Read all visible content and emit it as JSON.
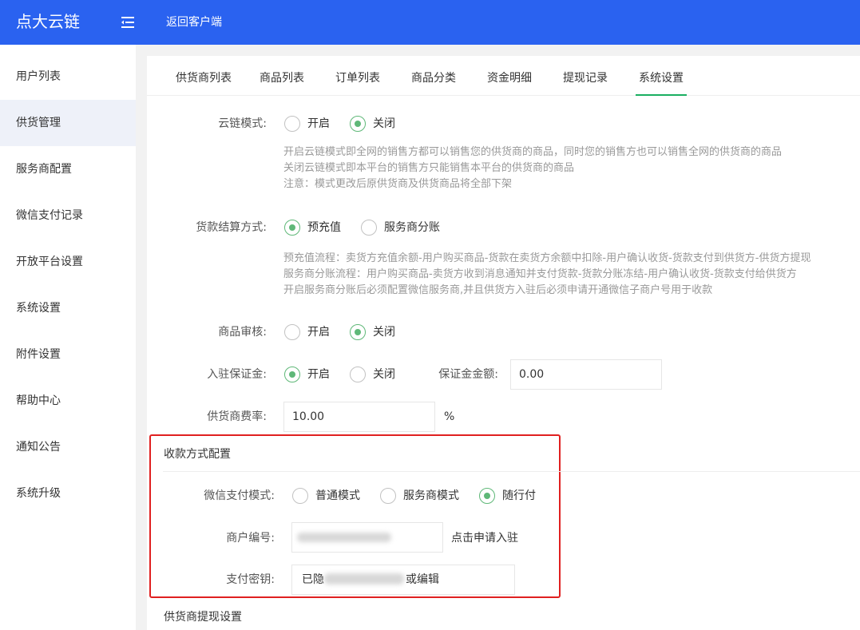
{
  "header": {
    "logo": "点大云链",
    "menu_icon": "menu-fold-icon",
    "back_link": "返回客户端",
    "bg_color": "#2a62f0"
  },
  "sidebar": {
    "items": [
      {
        "label": "用户列表"
      },
      {
        "label": "供货管理",
        "active": true
      },
      {
        "label": "服务商配置"
      },
      {
        "label": "微信支付记录"
      },
      {
        "label": "开放平台设置"
      },
      {
        "label": "系统设置"
      },
      {
        "label": "附件设置"
      },
      {
        "label": "帮助中心"
      },
      {
        "label": "通知公告"
      },
      {
        "label": "系统升级"
      }
    ]
  },
  "tabs": [
    {
      "label": "供货商列表"
    },
    {
      "label": "商品列表"
    },
    {
      "label": "订单列表"
    },
    {
      "label": "商品分类"
    },
    {
      "label": "资金明细"
    },
    {
      "label": "提现记录"
    },
    {
      "label": "系统设置",
      "active": true
    }
  ],
  "form": {
    "cloud_mode": {
      "label": "云链模式:",
      "options": [
        "开启",
        "关闭"
      ],
      "selected": "关闭",
      "hints": [
        "开启云链模式即全网的销售方都可以销售您的供货商的商品，同时您的销售方也可以销售全网的供货商的商品",
        "关闭云链模式即本平台的销售方只能销售本平台的供货商的商品",
        "注意：模式更改后原供货商及供货商品将全部下架"
      ]
    },
    "settlement": {
      "label": "货款结算方式:",
      "options": [
        "预充值",
        "服务商分账"
      ],
      "selected": "预充值",
      "hints": [
        "预充值流程：卖货方充值余额-用户购买商品-货款在卖货方余额中扣除-用户确认收货-货款支付到供货方-供货方提现",
        "服务商分账流程：用户购买商品-卖货方收到消息通知并支付货款-货款分账冻结-用户确认收货-货款支付给供货方",
        "开启服务商分账后必须配置微信服务商,并且供货方入驻后必须申请开通微信子商户号用于收款"
      ]
    },
    "product_review": {
      "label": "商品审核:",
      "options": [
        "开启",
        "关闭"
      ],
      "selected": "关闭"
    },
    "deposit": {
      "label": "入驻保证金:",
      "options": [
        "开启",
        "关闭"
      ],
      "selected": "开启",
      "amount_label": "保证金金额:",
      "amount_value": "0.00"
    },
    "fee_rate": {
      "label": "供货商费率:",
      "value": "10.00",
      "unit": "%"
    }
  },
  "payment_section": {
    "title": "收款方式配置",
    "wechat_mode": {
      "label": "微信支付模式:",
      "options": [
        "普通模式",
        "服务商模式",
        "随行付"
      ],
      "selected": "随行付"
    },
    "merchant_no": {
      "label": "商户编号:",
      "apply_link": "点击申请入驻"
    },
    "pay_key": {
      "label": "支付密钥:",
      "prefix": "已隐",
      "suffix": "或编辑"
    },
    "highlight_color": "#e02020"
  },
  "withdraw_section": {
    "title": "供货商提现设置"
  }
}
